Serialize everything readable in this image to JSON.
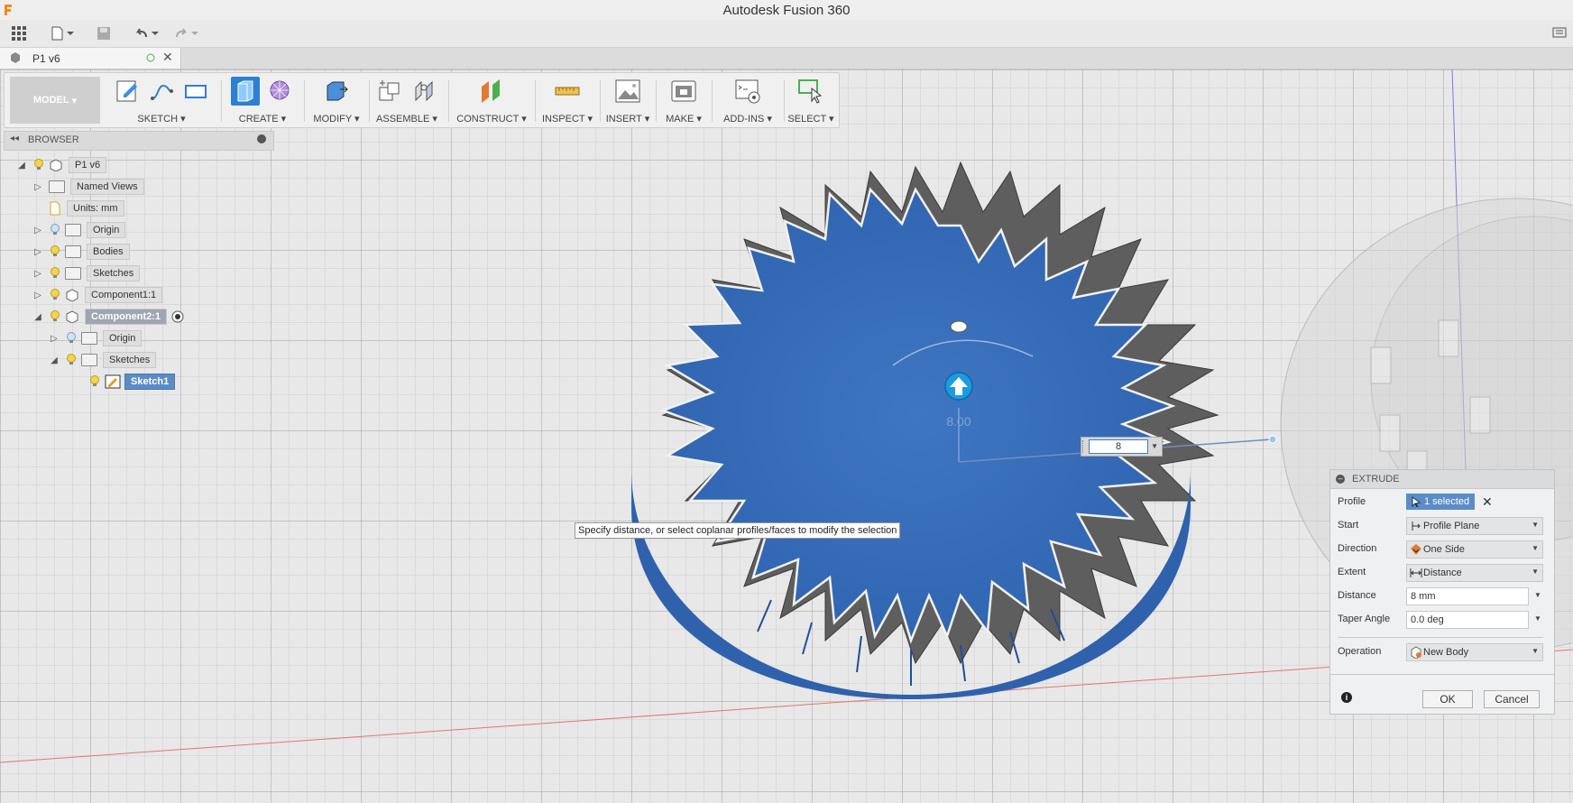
{
  "window": {
    "title": "Autodesk Fusion 360"
  },
  "document_tab": {
    "name": "P1 v6"
  },
  "toolbar": {
    "workspace": "MODEL",
    "groups": [
      {
        "label": "SKETCH"
      },
      {
        "label": "CREATE"
      },
      {
        "label": "MODIFY"
      },
      {
        "label": "ASSEMBLE"
      },
      {
        "label": "CONSTRUCT"
      },
      {
        "label": "INSPECT"
      },
      {
        "label": "INSERT"
      },
      {
        "label": "MAKE"
      },
      {
        "label": "ADD-INS"
      },
      {
        "label": "SELECT"
      }
    ]
  },
  "browser": {
    "title": "BROWSER",
    "items": [
      {
        "label": "P1 v6"
      },
      {
        "label": "Named Views"
      },
      {
        "label": "Units: mm"
      },
      {
        "label": "Origin"
      },
      {
        "label": "Bodies"
      },
      {
        "label": "Sketches"
      },
      {
        "label": "Component1:1"
      },
      {
        "label": "Component2:1"
      },
      {
        "label": "Origin"
      },
      {
        "label": "Sketches"
      },
      {
        "label": "Sketch1"
      }
    ]
  },
  "viewport": {
    "dimension_label": "8.00",
    "distance_input": "8",
    "tooltip": "Specify distance, or select coplanar profiles/faces to modify the selection"
  },
  "extrude": {
    "title": "EXTRUDE",
    "profile_label": "Profile",
    "profile_value": "1 selected",
    "start_label": "Start",
    "start_value": "Profile Plane",
    "direction_label": "Direction",
    "direction_value": "One Side",
    "extent_label": "Extent",
    "extent_value": "Distance",
    "distance_label": "Distance",
    "distance_value": "8 mm",
    "taper_label": "Taper Angle",
    "taper_value": "0.0 deg",
    "operation_label": "Operation",
    "operation_value": "New Body",
    "ok_label": "OK",
    "cancel_label": "Cancel"
  },
  "colors": {
    "accent": "#2d7fd3",
    "gear_face": "#3a6fb8",
    "gear_side": "#5a5a5a"
  }
}
